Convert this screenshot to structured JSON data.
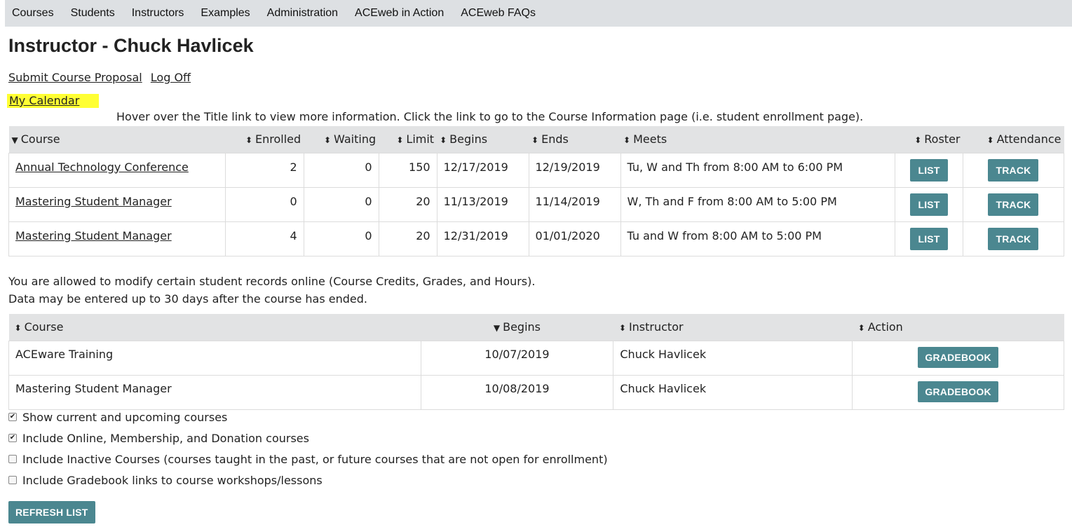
{
  "nav": [
    "Courses",
    "Students",
    "Instructors",
    "Examples",
    "Administration",
    "ACEweb in Action",
    "ACEweb FAQs"
  ],
  "page_title": "Instructor - Chuck Havlicek",
  "links": {
    "submit": "Submit Course Proposal",
    "logoff": "Log Off",
    "calendar": "My Calendar"
  },
  "hover_note": "Hover over the Title link to view more information. Click the link to go to the Course Information page (i.e. student enrollment page).",
  "courses_table": {
    "headers": [
      "Course",
      "Enrolled",
      "Waiting",
      "Limit",
      "Begins",
      "Ends",
      "Meets",
      "Roster",
      "Attendance"
    ],
    "rows": [
      {
        "course": "Annual Technology Conference",
        "enrolled": "2",
        "waiting": "0",
        "limit": "150",
        "begins": "12/17/2019",
        "ends": "12/19/2019",
        "meets": "Tu, W and Th from 8:00 AM to 6:00 PM"
      },
      {
        "course": "Mastering Student Manager",
        "enrolled": "0",
        "waiting": "0",
        "limit": "20",
        "begins": "11/13/2019",
        "ends": "11/14/2019",
        "meets": "W, Th and F from 8:00 AM to 5:00 PM"
      },
      {
        "course": "Mastering Student Manager",
        "enrolled": "4",
        "waiting": "0",
        "limit": "20",
        "begins": "12/31/2019",
        "ends": "01/01/2020",
        "meets": "Tu and W from 8:00 AM to 5:00 PM"
      }
    ],
    "list_label": "LIST",
    "track_label": "TRACK"
  },
  "modify_note": [
    "You are allowed to modify certain student records online (Course Credits, Grades, and Hours).",
    "Data may be entered up to 30 days after the course has ended."
  ],
  "grade_table": {
    "headers": [
      "Course",
      "Begins",
      "Instructor",
      "Action"
    ],
    "rows": [
      {
        "course": "ACEware Training",
        "begins": "10/07/2019",
        "instructor": "Chuck Havlicek"
      },
      {
        "course": "Mastering Student Manager",
        "begins": "10/08/2019",
        "instructor": "Chuck Havlicek"
      }
    ],
    "gradebook_label": "GRADEBOOK"
  },
  "options": [
    {
      "label": "Show current and upcoming courses",
      "checked": true
    },
    {
      "label": "Include Online, Membership, and Donation courses",
      "checked": true
    },
    {
      "label": "Include Inactive Courses (courses taught in the past, or future courses that are not open for enrollment)",
      "checked": false
    },
    {
      "label": "Include Gradebook links to course workshops/lessons",
      "checked": false
    }
  ],
  "refresh_label": "REFRESH LIST",
  "colors": {
    "button": "#4b8790",
    "highlight": "#ffff33",
    "nav_bg": "#dde0e3",
    "header_bg": "#e2e3e4"
  }
}
